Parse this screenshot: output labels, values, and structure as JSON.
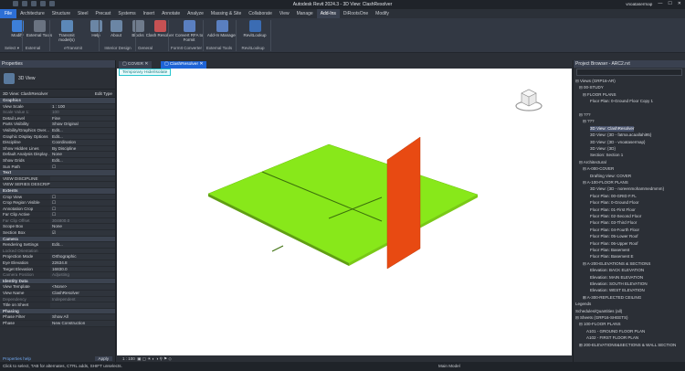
{
  "titlebar": {
    "title": "Autodesk Revit 2024.3 - 3D View: ClashResolver",
    "user": "vnoatasermap"
  },
  "menu": [
    "File",
    "Architecture",
    "Structure",
    "Steel",
    "Precast",
    "Systems",
    "Insert",
    "Annotate",
    "Analyze",
    "Massing & Site",
    "Collaborate",
    "View",
    "Manage",
    "Add-Ins",
    "DiRootsOne",
    "Modify"
  ],
  "menu_active": "Add-Ins",
  "ribbon": {
    "buttons": [
      {
        "label": "Modify",
        "color": "#3d7fd8"
      },
      {
        "label": "External Tools",
        "color": "#6a7381"
      },
      {
        "label": "Transmit model(s)",
        "color": "#5c88b8"
      },
      {
        "label": "Help",
        "color": "#6b86a5"
      },
      {
        "label": "About",
        "color": "#6b86a5"
      },
      {
        "label": "Blocks",
        "color": "#6f7b8c"
      },
      {
        "label": "Clash Resolver",
        "color": "#c65153"
      },
      {
        "label": "Convert RFA to Formit",
        "color": "#5a7fc0"
      },
      {
        "label": "Add-In Manager",
        "color": "#5a7fc0"
      },
      {
        "label": "RevitLookup",
        "color": "#3b6cb3"
      }
    ],
    "groups": [
      "Select ▾",
      "External",
      "eTransmit",
      "Interior Design",
      "General",
      "FormIt Converter",
      "External Tools",
      "RevitLookup"
    ]
  },
  "properties": {
    "title": "Properties",
    "type_name": "3D View",
    "instance": "3D View: ClashResolver",
    "edit_type": "Edit Type",
    "rows": [
      {
        "k": "Graphics",
        "v": "",
        "sec": true
      },
      {
        "k": "View Scale",
        "v": "1 : 100"
      },
      {
        "k": "Scale Value  1:",
        "v": "100",
        "dim": true
      },
      {
        "k": "Detail Level",
        "v": "Fine"
      },
      {
        "k": "Parts Visibility",
        "v": "Show Original"
      },
      {
        "k": "Visibility/Graphics Over...",
        "v": "Edit..."
      },
      {
        "k": "Graphic Display Options",
        "v": "Edit..."
      },
      {
        "k": "Discipline",
        "v": "Coordination"
      },
      {
        "k": "Show Hidden Lines",
        "v": "By Discipline"
      },
      {
        "k": "Default Analysis Display ...",
        "v": "None"
      },
      {
        "k": "Show Grids",
        "v": "Edit..."
      },
      {
        "k": "Sun Path",
        "v": "☐"
      },
      {
        "k": "Text",
        "v": "",
        "sec": true
      },
      {
        "k": "VIEW DISCIPLINE",
        "v": ""
      },
      {
        "k": "VIEW SERIES DESCRIPTION",
        "v": ""
      },
      {
        "k": "Extents",
        "v": "",
        "sec": true
      },
      {
        "k": "Crop View",
        "v": "☐"
      },
      {
        "k": "Crop Region Visible",
        "v": "☐"
      },
      {
        "k": "Annotation Crop",
        "v": "☐"
      },
      {
        "k": "Far Clip Active",
        "v": "☐"
      },
      {
        "k": "Far Clip Offset",
        "v": "304800.0",
        "dim": true
      },
      {
        "k": "Scope Box",
        "v": "None"
      },
      {
        "k": "Section Box",
        "v": "☑"
      },
      {
        "k": "Camera",
        "v": "",
        "sec": true
      },
      {
        "k": "Rendering Settings",
        "v": "Edit..."
      },
      {
        "k": "Locked Orientation",
        "v": "",
        "dim": true
      },
      {
        "k": "Projection Mode",
        "v": "Orthographic"
      },
      {
        "k": "Eye Elevation",
        "v": "22634.8"
      },
      {
        "k": "Target Elevation",
        "v": "16830.0"
      },
      {
        "k": "Camera Position",
        "v": "Adjusting",
        "dim": true
      },
      {
        "k": "Identity Data",
        "v": "",
        "sec": true
      },
      {
        "k": "View Template",
        "v": "<None>"
      },
      {
        "k": "View Name",
        "v": "ClashResolver"
      },
      {
        "k": "Dependency",
        "v": "Independent",
        "dim": true
      },
      {
        "k": "Title on Sheet",
        "v": ""
      },
      {
        "k": "Phasing",
        "v": "",
        "sec": true
      },
      {
        "k": "Phase Filter",
        "v": "Show All"
      },
      {
        "k": "Phase",
        "v": "New Construction"
      }
    ],
    "help": "Properties help",
    "apply": "Apply"
  },
  "tabs": [
    "COVER",
    "ClashResolver"
  ],
  "canvas": {
    "banner": "Temporary Hide/Isolate",
    "floor_color": "#88e81a",
    "wall_color": "#e84a12"
  },
  "viewbar": {
    "scale": "1 : 100"
  },
  "browser": {
    "title": "Project Browser - ARC2.rvt",
    "items": [
      {
        "t": "⊟ Views (GRP16-AR)",
        "x": 2,
        "y": 0
      },
      {
        "t": "⊟ 00-STUDY",
        "x": 6,
        "y": 1
      },
      {
        "t": "⊟ FLOOR PLANS",
        "x": 10,
        "y": 2
      },
      {
        "t": "Floor Plan: 0-Ground Floor Copy 1",
        "x": 18,
        "y": 3
      },
      {
        "t": "⊟ ???",
        "x": 6,
        "y": 5
      },
      {
        "t": "⊟ ???",
        "x": 10,
        "y": 6
      },
      {
        "t": "3D View: ClashResolver",
        "x": 18,
        "y": 7,
        "sel": true
      },
      {
        "t": "3D View: {3D - fatma.acaallahi95}",
        "x": 18,
        "y": 8
      },
      {
        "t": "3D View: {3D - vnoatasermap}",
        "x": 18,
        "y": 9
      },
      {
        "t": "3D View: {3D}",
        "x": 18,
        "y": 10
      },
      {
        "t": "Section: Section 1",
        "x": 18,
        "y": 11
      },
      {
        "t": "⊟ Architectural",
        "x": 6,
        "y": 12
      },
      {
        "t": "⊟ A-000-COVER",
        "x": 10,
        "y": 13
      },
      {
        "t": "Drafting View: COVER",
        "x": 18,
        "y": 14
      },
      {
        "t": "⊟ A-100-FLOOR PLANS",
        "x": 10,
        "y": 15
      },
      {
        "t": "3D View: {3D - noreenmohammedmmm}",
        "x": 18,
        "y": 16
      },
      {
        "t": "Floor Plan: 00-GRID F.FL",
        "x": 18,
        "y": 17
      },
      {
        "t": "Floor Plan: 0-Ground Floor",
        "x": 18,
        "y": 18
      },
      {
        "t": "Floor Plan: 01-First Floor",
        "x": 18,
        "y": 19
      },
      {
        "t": "Floor Plan: 02-Second Floor",
        "x": 18,
        "y": 20
      },
      {
        "t": "Floor Plan: 03-Third Floor",
        "x": 18,
        "y": 21
      },
      {
        "t": "Floor Plan: 04-Fourth Floor",
        "x": 18,
        "y": 22
      },
      {
        "t": "Floor Plan: 05-Lower Roof",
        "x": 18,
        "y": 23
      },
      {
        "t": "Floor Plan: 06-Upper Roof",
        "x": 18,
        "y": 24
      },
      {
        "t": "Floor Plan: Basement",
        "x": 18,
        "y": 25
      },
      {
        "t": "Floor Plan: Basement E",
        "x": 18,
        "y": 26
      },
      {
        "t": "⊟ A-200-ELEVATIONS & SECTIONS",
        "x": 10,
        "y": 27
      },
      {
        "t": "Elevation: BACK ELEVATION",
        "x": 18,
        "y": 28
      },
      {
        "t": "Elevation: MAIN ELEVATION",
        "x": 18,
        "y": 29
      },
      {
        "t": "Elevation: SOUTH ELEVATION",
        "x": 18,
        "y": 30
      },
      {
        "t": "Elevation: WEST ELEVATION",
        "x": 18,
        "y": 31
      },
      {
        "t": "⊞ A-300-REFLECTED CEILING",
        "x": 10,
        "y": 32
      },
      {
        "t": "Legends",
        "x": 2,
        "y": 33
      },
      {
        "t": "Schedules/Quantities (all)",
        "x": 2,
        "y": 34
      },
      {
        "t": "⊟ Sheets (GRP16-SHEETS)",
        "x": 2,
        "y": 35
      },
      {
        "t": "⊟ 100-FLOOR PLANS",
        "x": 6,
        "y": 36
      },
      {
        "t": "A101 - GROUND FLOOR PLAN",
        "x": 14,
        "y": 37
      },
      {
        "t": "A102 - FIRST FLOOR PLAN",
        "x": 14,
        "y": 38
      },
      {
        "t": "⊞ 200-ELEVATIONS&SECTIONS & WALL SECTION",
        "x": 6,
        "y": 39
      }
    ]
  },
  "status": {
    "hint": "Click to select, TAB for alternates, CTRL adds, SHIFT unselects.",
    "model": "Main Model"
  }
}
